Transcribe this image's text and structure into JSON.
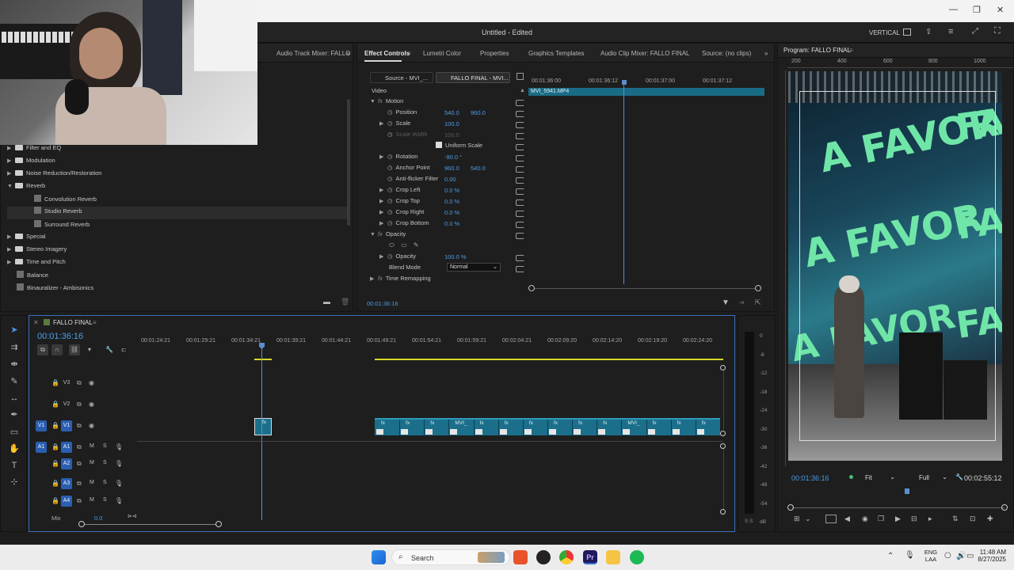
{
  "window": {
    "minimize": "—",
    "restore": "❐",
    "close": "✕"
  },
  "header": {
    "title": "Untitled - Edited",
    "workspace": "VERTICAL"
  },
  "audio_effects": {
    "tab": "Audio Track Mixer: FALLO",
    "items": [
      {
        "label": "Filter and EQ",
        "type": "folder"
      },
      {
        "label": "Modulation",
        "type": "folder"
      },
      {
        "label": "Noise Reduction/Restoration",
        "type": "folder"
      },
      {
        "label": "Reverb",
        "type": "folder",
        "expanded": true
      },
      {
        "label": "Convolution Reverb",
        "type": "effect"
      },
      {
        "label": "Studio Reverb",
        "type": "effect",
        "selected": true
      },
      {
        "label": "Surround Reverb",
        "type": "effect"
      },
      {
        "label": "Special",
        "type": "folder"
      },
      {
        "label": "Stereo Imagery",
        "type": "folder"
      },
      {
        "label": "Time and Pitch",
        "type": "folder"
      },
      {
        "label": "Balance",
        "type": "effect"
      },
      {
        "label": "Binauralizer - Ambisonics",
        "type": "effect"
      }
    ]
  },
  "effect_controls": {
    "tabs": [
      "Effect Controls",
      "Lumetri Color",
      "Properties",
      "Graphics Templates",
      "Audio Clip Mixer: FALLO FINAL",
      "Source: (no clips)"
    ],
    "source_tab": "Source - MVI_...",
    "seq_tab": "FALLO FINAL - MVI...",
    "section_video": "Video",
    "rows": [
      {
        "label": "Motion",
        "group": true
      },
      {
        "label": "Position",
        "v1": "540.0",
        "v2": "960.0"
      },
      {
        "label": "Scale",
        "v1": "100.0"
      },
      {
        "label": "Scale Width",
        "v1": "100.0",
        "disabled": true
      },
      {
        "label": "Uniform Scale",
        "checkbox": true
      },
      {
        "label": "Rotation",
        "v1": "-90.0 °"
      },
      {
        "label": "Anchor Point",
        "v1": "960.0",
        "v2": "540.0"
      },
      {
        "label": "Anti-flicker Filter",
        "v1": "0.00"
      },
      {
        "label": "Crop Left",
        "v1": "0.0 %"
      },
      {
        "label": "Crop Top",
        "v1": "0.0 %"
      },
      {
        "label": "Crop Right",
        "v1": "0.0 %"
      },
      {
        "label": "Crop Bottom",
        "v1": "0.0 %"
      },
      {
        "label": "Opacity",
        "group": true
      },
      {
        "label": "Opacity",
        "v1": "100.0 %"
      },
      {
        "label": "Blend Mode",
        "select": "Normal"
      },
      {
        "label": "Time Remapping",
        "group": true
      }
    ],
    "ruler": [
      "00:01:36:00",
      "00:01:36:12",
      "00:01:37:00",
      "00:01:37:12"
    ],
    "clip_label": "MVI_5941.MP4",
    "timecode": "00:01:36:16"
  },
  "program": {
    "tab": "Program: FALLO FINAL",
    "timecode": "00:01:36:16",
    "fit": "Fit",
    "quality": "Full",
    "duration": "00:02:55:12",
    "ruler": [
      "200",
      "400",
      "600",
      "800",
      "1000"
    ],
    "overlay_text": [
      "A FAVOR",
      "A FAVOR",
      "A FAVOR",
      "FA",
      "FA",
      "FA"
    ]
  },
  "timeline": {
    "sequence": "FALLO FINAL",
    "timecode": "00:01:36:16",
    "ruler": [
      "00:01:24:21",
      "00:01:29:21",
      "00:01:34:21",
      "00:01:39:21",
      "00:01:44:21",
      "00:01:49:21",
      "00:01:54:21",
      "00:01:59:21",
      "00:02:04:21",
      "00:02:09:20",
      "00:02:14:20",
      "00:02:19:20",
      "00:02:24:20"
    ],
    "video_tracks": [
      "V3",
      "V2",
      "V1"
    ],
    "audio_tracks": [
      "A1",
      "A2",
      "A3",
      "A4"
    ],
    "mix_label": "Mix",
    "mix_value": "0.0",
    "track_btn": {
      "mute": "M",
      "solo": "S"
    },
    "clip_labels": [
      "fx",
      "fx",
      "fx",
      "fx",
      "MVI_",
      "fx",
      "fx",
      "fx",
      "fx",
      "fx",
      "fx",
      "MVI_",
      "fx",
      "fx",
      "fx"
    ],
    "meter_scale": [
      "0",
      "-6",
      "-12",
      "-18",
      "-24",
      "-30",
      "-36",
      "-42",
      "-48",
      "-54",
      "dB"
    ],
    "meter_foot": "S S"
  },
  "taskbar": {
    "search": "Search",
    "lang1": "ENG",
    "lang2": "LAA",
    "time": "11:48 AM",
    "date": "8/27/2025"
  }
}
